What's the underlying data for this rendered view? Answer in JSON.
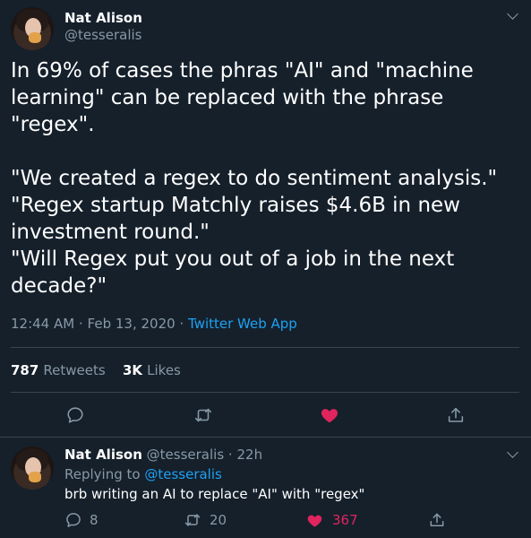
{
  "tweet": {
    "author_name": "Nat Alison",
    "author_handle": "@tesseralis",
    "text": "In 69% of cases the phras \"AI\" and \"machine learning\" can be replaced with the phrase \"regex\".\n\n\"We created a regex to do sentiment analysis.\"\n\"Regex startup Matchly raises $4.6B in new investment round.\"\n\"Will Regex put you out of a job in the next decade?\"",
    "time": "12:44 AM",
    "date": "Feb 13, 2020",
    "source": "Twitter Web App",
    "retweets_count": "787",
    "retweets_label": "Retweets",
    "likes_count": "3K",
    "likes_label": "Likes"
  },
  "reply": {
    "author_name": "Nat Alison",
    "author_handle": "@tesseralis",
    "age": "22h",
    "replying_to_label": "Replying to",
    "replying_to_handle": "@tesseralis",
    "text": "brb writing an AI to replace \"AI\" with \"regex\"",
    "reply_count": "8",
    "retweet_count": "20",
    "like_count": "367"
  },
  "separator": "·",
  "colors": {
    "background": "#15202b",
    "text_secondary": "#8899a6",
    "link": "#1da1f2",
    "like": "#e0245e",
    "divider": "#38444d"
  },
  "icons": {
    "reply": "speech-bubble",
    "retweet": "retweet-arrows",
    "like": "heart-filled",
    "share": "share-upload",
    "menu": "chevron-down"
  }
}
